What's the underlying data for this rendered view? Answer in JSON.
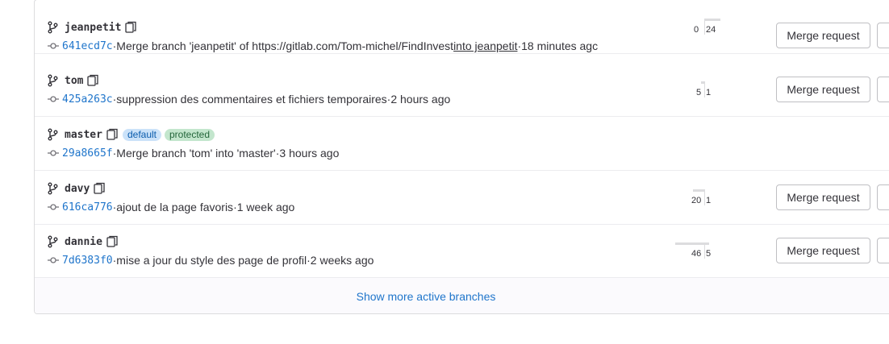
{
  "branches": [
    {
      "name": "jeanpetit",
      "sha": "641ecd7c",
      "message_pre": "Merge branch 'jeanpetit' of https://gitlab.com/Tom-michel/FindInvest",
      "message_link": " into jeanpetit",
      "time": "18 minutes agc",
      "behind": "0",
      "ahead": "24",
      "mr_label": "Merge request"
    },
    {
      "name": "tom",
      "sha": "425a263c",
      "message": "suppression des commentaires et fichiers temporaires",
      "time": "2 hours ago",
      "behind": "5",
      "ahead": "1",
      "mr_label": "Merge request"
    },
    {
      "name": "master",
      "sha": "29a8665f",
      "message": "Merge branch 'tom' into 'master'",
      "time": "3 hours ago",
      "badges": [
        "default",
        "protected"
      ]
    },
    {
      "name": "davy",
      "sha": "616ca776",
      "message": "ajout de la page favoris",
      "time": "1 week ago",
      "behind": "20",
      "ahead": "1",
      "mr_label": "Merge request"
    },
    {
      "name": "dannie",
      "sha": "7d6383f0",
      "message": "mise a jour du style des page de profil",
      "time": "2 weeks ago",
      "behind": "46",
      "ahead": "5",
      "mr_label": "Merge request"
    }
  ],
  "separator": " · ",
  "footer": {
    "show_more_label": "Show more active branches"
  },
  "colors": {
    "link": "#1f75cb",
    "default_badge_bg": "#cbe2f9",
    "protected_badge_bg": "#c3e6cd",
    "border": "#dcdcde"
  },
  "icons": {
    "branch": "branch-icon",
    "copy": "copy-icon",
    "commit": "commit-icon"
  }
}
